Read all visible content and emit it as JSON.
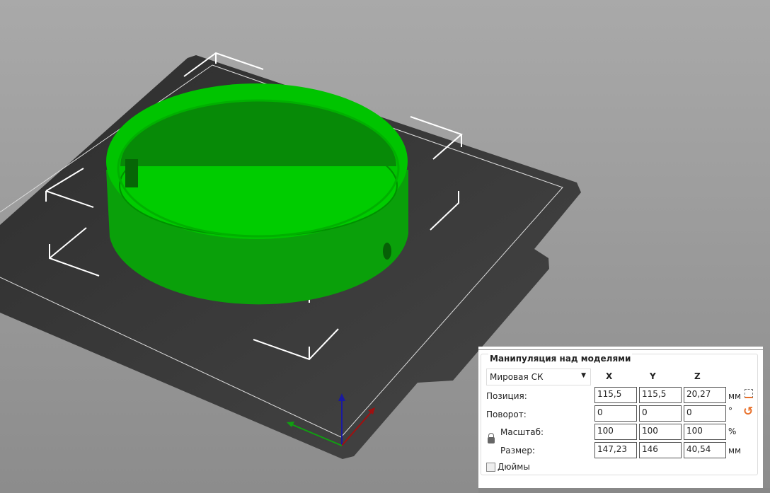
{
  "panel": {
    "title": "Манипуляция над моделями",
    "coord_system": "Мировая СК",
    "headers": {
      "x": "X",
      "y": "Y",
      "z": "Z"
    },
    "rows": {
      "position": {
        "label": "Позиция:",
        "x": "115,5",
        "y": "115,5",
        "z": "20,27",
        "unit": "мм"
      },
      "rotation": {
        "label": "Поворот:",
        "x": "0",
        "y": "0",
        "z": "0",
        "unit": "°"
      },
      "scale": {
        "label": "Масштаб:",
        "x": "100",
        "y": "100",
        "z": "100",
        "unit": "%"
      },
      "size": {
        "label": "Размер:",
        "x": "147,23",
        "y": "146",
        "z": "40,54",
        "unit": "мм"
      }
    },
    "inches_label": "Дюймы",
    "inches_checked": false
  },
  "colors": {
    "model": "#00c800",
    "bed": "#3a3a3a",
    "accent": "#e8702a"
  }
}
